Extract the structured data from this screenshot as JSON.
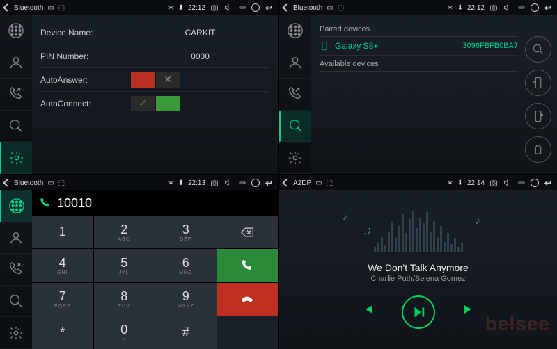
{
  "panes": [
    {
      "title": "Bluetooth",
      "time": "22:12",
      "active_tab": 4,
      "settings": [
        {
          "label": "Device Name:",
          "value": "CARKIT"
        },
        {
          "label": "PIN Number:",
          "value": "0000"
        },
        {
          "label": "AutoAnswer:",
          "toggle": "off"
        },
        {
          "label": "AutoConnect:",
          "toggle": "on"
        }
      ]
    },
    {
      "title": "Bluetooth",
      "time": "22:12",
      "active_tab": 3,
      "paired_label": "Paired devices",
      "available_label": "Available devices",
      "devices": [
        {
          "name": "Galaxy S8+",
          "mac": "3096FBFB0BA7"
        }
      ]
    },
    {
      "title": "Bluetooth",
      "time": "22:13",
      "active_tab": 0,
      "dial_number": "10010",
      "keys": [
        {
          "n": "1",
          "l": ""
        },
        {
          "n": "2",
          "l": "ABC"
        },
        {
          "n": "3",
          "l": "DEF"
        },
        {
          "type": "back"
        },
        {
          "n": "4",
          "l": "GHI"
        },
        {
          "n": "5",
          "l": "JKL"
        },
        {
          "n": "6",
          "l": "MNO"
        },
        {
          "type": "call"
        },
        {
          "n": "7",
          "l": "PQRS"
        },
        {
          "n": "8",
          "l": "TUV"
        },
        {
          "n": "9",
          "l": "WXYZ"
        },
        {
          "type": "hang"
        },
        {
          "n": "*",
          "l": ""
        },
        {
          "n": "0",
          "l": "+"
        },
        {
          "n": "#",
          "l": ""
        },
        {
          "type": "blank"
        }
      ]
    },
    {
      "title": "A2DP",
      "time": "22:14",
      "track": "We Don't Talk Anymore",
      "artist": "Charlie Puth/Selena Gomez",
      "watermark": "belsee"
    }
  ],
  "sidebar_icons": [
    "keypad",
    "contacts",
    "call-log",
    "search",
    "settings"
  ]
}
